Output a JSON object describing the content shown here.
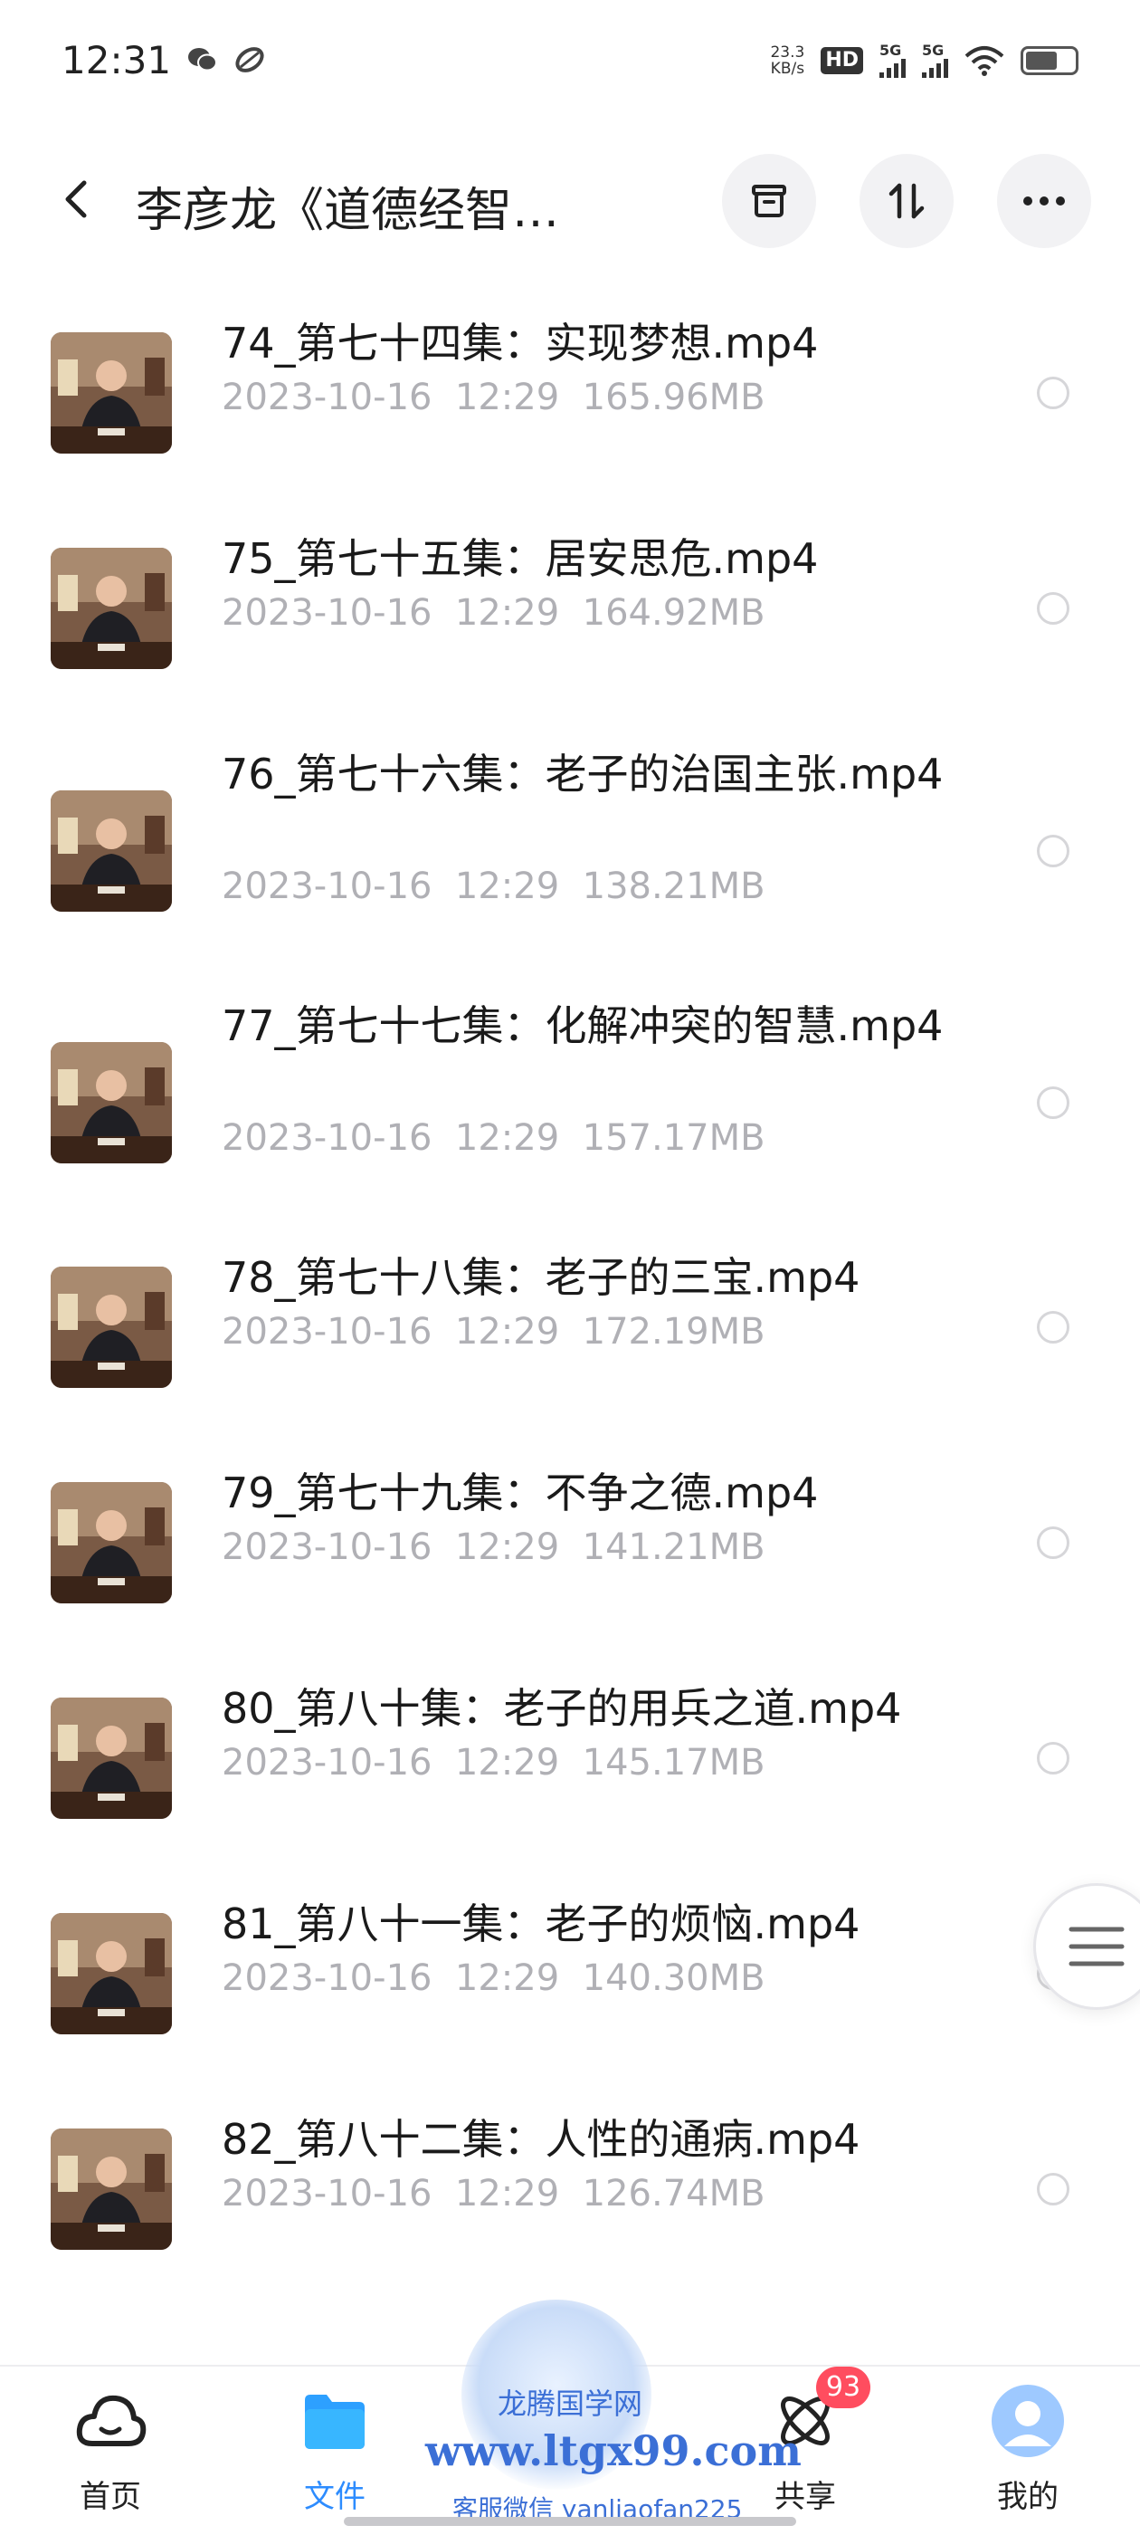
{
  "status_bar": {
    "time": "12:31",
    "net_speed_value": "23.3",
    "net_speed_unit": "KB/s",
    "hd_label": "HD",
    "signal_label_1": "5G",
    "signal_label_2": "5G",
    "icons": [
      "wechat-icon",
      "app-leaf-icon",
      "wifi-icon",
      "battery-icon"
    ]
  },
  "header": {
    "title": "李彦龙《道德经智…",
    "actions": [
      "archive-icon",
      "sort-icon",
      "more-icon"
    ]
  },
  "files": [
    {
      "name": "74_第七十四集：实现梦想.mp4",
      "date": "2023-10-16",
      "time": "12:29",
      "size": "165.96MB"
    },
    {
      "name": "75_第七十五集：居安思危.mp4",
      "date": "2023-10-16",
      "time": "12:29",
      "size": "164.92MB"
    },
    {
      "name": "76_第七十六集：老子的治国主张.mp4",
      "date": "2023-10-16",
      "time": "12:29",
      "size": "138.21MB"
    },
    {
      "name": "77_第七十七集：化解冲突的智慧.mp4",
      "date": "2023-10-16",
      "time": "12:29",
      "size": "157.17MB"
    },
    {
      "name": "78_第七十八集：老子的三宝.mp4",
      "date": "2023-10-16",
      "time": "12:29",
      "size": "172.19MB"
    },
    {
      "name": "79_第七十九集：不争之德.mp4",
      "date": "2023-10-16",
      "time": "12:29",
      "size": "141.21MB"
    },
    {
      "name": "80_第八十集：老子的用兵之道.mp4",
      "date": "2023-10-16",
      "time": "12:29",
      "size": "145.17MB"
    },
    {
      "name": "81_第八十一集：老子的烦恼.mp4",
      "date": "2023-10-16",
      "time": "12:29",
      "size": "140.30MB"
    },
    {
      "name": "82_第八十二集：人性的通病.mp4",
      "date": "2023-10-16",
      "time": "12:29",
      "size": "126.74MB"
    }
  ],
  "watermark": {
    "line1": "龙腾国学网",
    "line2": "www.ltgx99.com",
    "line3": "客服微信 yanliaofan225"
  },
  "bottom_nav": {
    "items": [
      {
        "label": "首页",
        "icon": "cloud-home-icon",
        "active": false
      },
      {
        "label": "文件",
        "icon": "folder-icon",
        "active": true
      },
      {
        "label": "共享",
        "icon": "share-atom-icon",
        "active": false,
        "badge": "93"
      },
      {
        "label": "我的",
        "icon": "avatar-icon",
        "active": false
      }
    ]
  },
  "colors": {
    "accent": "#2d8cff",
    "meta_text": "#b0b0b5",
    "badge": "#ff4d5f"
  }
}
